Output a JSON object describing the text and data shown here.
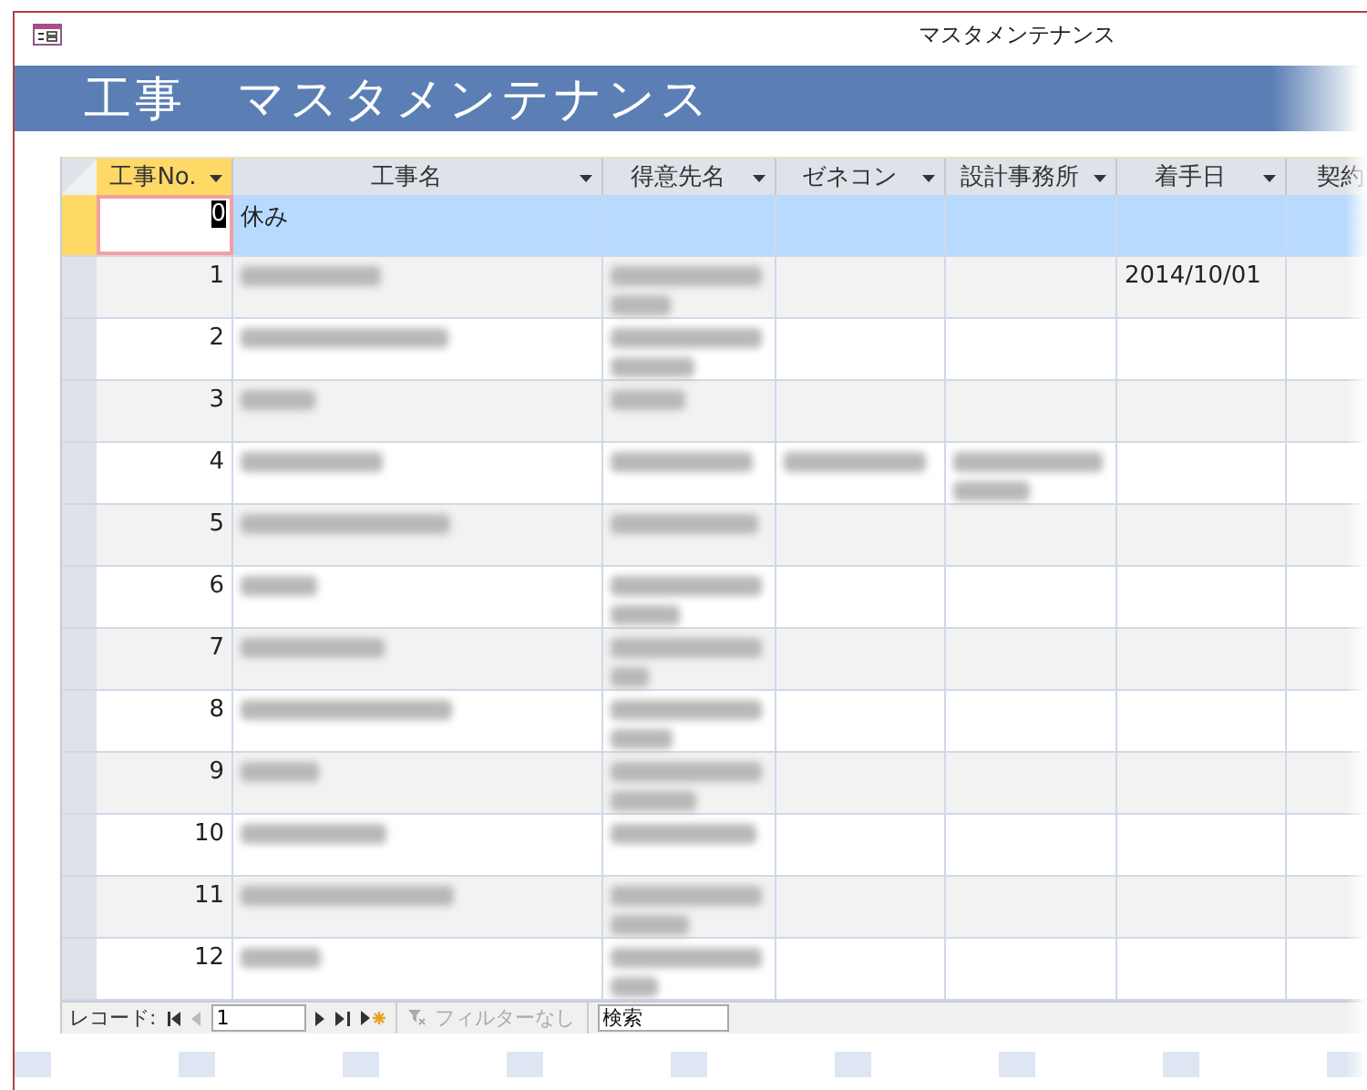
{
  "window": {
    "title": "マスタメンテナンス"
  },
  "form_header": {
    "title": "工事　マスタメンテナンス"
  },
  "table": {
    "columns": [
      {
        "label": "工事No.",
        "selected": true,
        "filter": true
      },
      {
        "label": "工事名",
        "selected": false,
        "filter": true
      },
      {
        "label": "得意先名",
        "selected": false,
        "filter": true
      },
      {
        "label": "ゼネコン",
        "selected": false,
        "filter": true
      },
      {
        "label": "設計事務所",
        "selected": false,
        "filter": true
      },
      {
        "label": "着手日",
        "selected": false,
        "filter": true
      },
      {
        "label": "契約",
        "selected": false,
        "filter": false
      }
    ],
    "rows": [
      {
        "selected": true,
        "cells": [
          {
            "kind": "text",
            "text": "0"
          },
          {
            "kind": "text",
            "text": "休み"
          },
          {
            "kind": "empty"
          },
          {
            "kind": "empty"
          },
          {
            "kind": "empty"
          },
          {
            "kind": "empty"
          },
          {
            "kind": "empty"
          }
        ]
      },
      {
        "selected": false,
        "cells": [
          {
            "kind": "text",
            "text": "1"
          },
          {
            "kind": "blurred",
            "wrap": false
          },
          {
            "kind": "blurred",
            "wrap": true
          },
          {
            "kind": "empty"
          },
          {
            "kind": "empty"
          },
          {
            "kind": "text",
            "text": "2014/10/01"
          },
          {
            "kind": "empty"
          }
        ]
      },
      {
        "selected": false,
        "cells": [
          {
            "kind": "text",
            "text": "2"
          },
          {
            "kind": "blurred",
            "wrap": false
          },
          {
            "kind": "blurred",
            "wrap": true
          },
          {
            "kind": "empty"
          },
          {
            "kind": "empty"
          },
          {
            "kind": "empty"
          },
          {
            "kind": "empty"
          }
        ]
      },
      {
        "selected": false,
        "cells": [
          {
            "kind": "text",
            "text": "3"
          },
          {
            "kind": "blurred",
            "wrap": false
          },
          {
            "kind": "blurred",
            "wrap": false
          },
          {
            "kind": "empty"
          },
          {
            "kind": "empty"
          },
          {
            "kind": "empty"
          },
          {
            "kind": "empty"
          }
        ]
      },
      {
        "selected": false,
        "cells": [
          {
            "kind": "text",
            "text": "4"
          },
          {
            "kind": "blurred",
            "wrap": false
          },
          {
            "kind": "blurred",
            "wrap": false
          },
          {
            "kind": "blurred",
            "wrap": false
          },
          {
            "kind": "blurred",
            "wrap": true
          },
          {
            "kind": "empty"
          },
          {
            "kind": "empty"
          }
        ]
      },
      {
        "selected": false,
        "cells": [
          {
            "kind": "text",
            "text": "5"
          },
          {
            "kind": "blurred",
            "wrap": false
          },
          {
            "kind": "blurred",
            "wrap": false
          },
          {
            "kind": "empty"
          },
          {
            "kind": "empty"
          },
          {
            "kind": "empty"
          },
          {
            "kind": "empty"
          }
        ]
      },
      {
        "selected": false,
        "cells": [
          {
            "kind": "text",
            "text": "6"
          },
          {
            "kind": "blurred",
            "wrap": false
          },
          {
            "kind": "blurred",
            "wrap": true
          },
          {
            "kind": "empty"
          },
          {
            "kind": "empty"
          },
          {
            "kind": "empty"
          },
          {
            "kind": "empty"
          }
        ]
      },
      {
        "selected": false,
        "cells": [
          {
            "kind": "text",
            "text": "7"
          },
          {
            "kind": "blurred",
            "wrap": false
          },
          {
            "kind": "blurred",
            "wrap": true
          },
          {
            "kind": "empty"
          },
          {
            "kind": "empty"
          },
          {
            "kind": "empty"
          },
          {
            "kind": "empty"
          }
        ]
      },
      {
        "selected": false,
        "cells": [
          {
            "kind": "text",
            "text": "8"
          },
          {
            "kind": "blurred",
            "wrap": false
          },
          {
            "kind": "blurred",
            "wrap": true
          },
          {
            "kind": "empty"
          },
          {
            "kind": "empty"
          },
          {
            "kind": "empty"
          },
          {
            "kind": "empty"
          }
        ]
      },
      {
        "selected": false,
        "cells": [
          {
            "kind": "text",
            "text": "9"
          },
          {
            "kind": "blurred",
            "wrap": false
          },
          {
            "kind": "blurred",
            "wrap": true
          },
          {
            "kind": "empty"
          },
          {
            "kind": "empty"
          },
          {
            "kind": "empty"
          },
          {
            "kind": "empty"
          }
        ]
      },
      {
        "selected": false,
        "cells": [
          {
            "kind": "text",
            "text": "10"
          },
          {
            "kind": "blurred",
            "wrap": false
          },
          {
            "kind": "blurred",
            "wrap": false
          },
          {
            "kind": "empty"
          },
          {
            "kind": "empty"
          },
          {
            "kind": "empty"
          },
          {
            "kind": "empty"
          }
        ]
      },
      {
        "selected": false,
        "cells": [
          {
            "kind": "text",
            "text": "11"
          },
          {
            "kind": "blurred",
            "wrap": false
          },
          {
            "kind": "blurred",
            "wrap": true
          },
          {
            "kind": "empty"
          },
          {
            "kind": "empty"
          },
          {
            "kind": "empty"
          },
          {
            "kind": "empty"
          }
        ]
      },
      {
        "selected": false,
        "cells": [
          {
            "kind": "text",
            "text": "12"
          },
          {
            "kind": "blurred",
            "wrap": false
          },
          {
            "kind": "blurred",
            "wrap": true
          },
          {
            "kind": "empty"
          },
          {
            "kind": "empty"
          },
          {
            "kind": "empty"
          },
          {
            "kind": "empty"
          }
        ]
      }
    ]
  },
  "navigation": {
    "label": "レコード:",
    "record": "1",
    "filter": {
      "label": "フィルターなし",
      "disabled": true
    },
    "search": {
      "placeholder": "検索"
    }
  }
}
